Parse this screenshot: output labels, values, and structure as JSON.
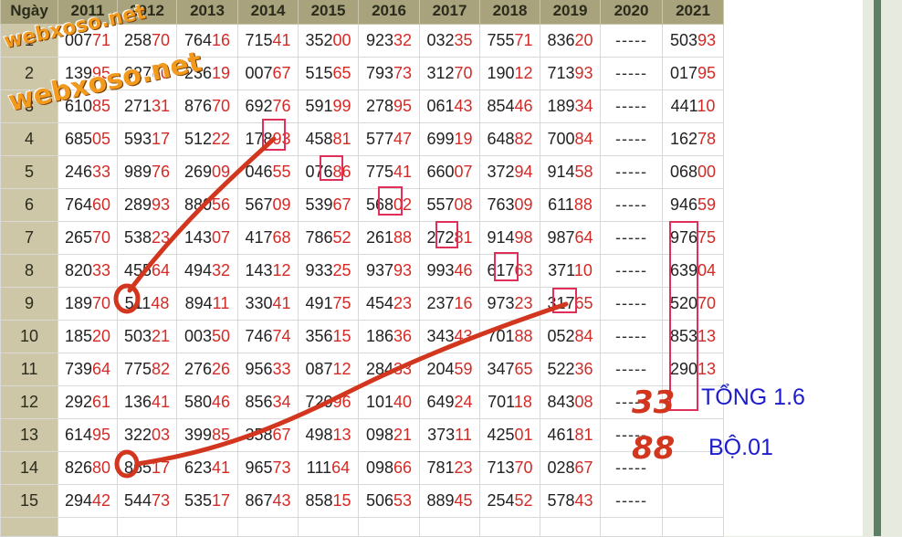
{
  "header": {
    "day_label": "Ngày",
    "years": [
      "2011",
      "2012",
      "2013",
      "2014",
      "2015",
      "2016",
      "2017",
      "2018",
      "2019",
      "2020",
      "2021"
    ]
  },
  "rows": [
    {
      "day": "1",
      "cells": [
        [
          "007",
          "71"
        ],
        [
          "258",
          "70"
        ],
        [
          "764",
          "16"
        ],
        [
          "715",
          "41"
        ],
        [
          "352",
          "00"
        ],
        [
          "923",
          "32"
        ],
        [
          "032",
          "35"
        ],
        [
          "755",
          "71"
        ],
        [
          "836",
          "20"
        ],
        [
          "-----",
          ""
        ],
        [
          "503",
          "93"
        ]
      ]
    },
    {
      "day": "2",
      "cells": [
        [
          "139",
          "95"
        ],
        [
          "627",
          "60"
        ],
        [
          "236",
          "19"
        ],
        [
          "007",
          "67"
        ],
        [
          "515",
          "65"
        ],
        [
          "793",
          "73"
        ],
        [
          "312",
          "70"
        ],
        [
          "190",
          "12"
        ],
        [
          "713",
          "93"
        ],
        [
          "-----",
          ""
        ],
        [
          "017",
          "95"
        ]
      ]
    },
    {
      "day": "3",
      "cells": [
        [
          "610",
          "85"
        ],
        [
          "271",
          "31"
        ],
        [
          "876",
          "70"
        ],
        [
          "692",
          "76"
        ],
        [
          "591",
          "99"
        ],
        [
          "278",
          "95"
        ],
        [
          "061",
          "43"
        ],
        [
          "854",
          "46"
        ],
        [
          "189",
          "34"
        ],
        [
          "-----",
          ""
        ],
        [
          "441",
          "10"
        ]
      ]
    },
    {
      "day": "4",
      "cells": [
        [
          "685",
          "05"
        ],
        [
          "593",
          "17"
        ],
        [
          "512",
          "22"
        ],
        [
          "178",
          "93"
        ],
        [
          "458",
          "81"
        ],
        [
          "577",
          "47"
        ],
        [
          "699",
          "19"
        ],
        [
          "648",
          "82"
        ],
        [
          "700",
          "84"
        ],
        [
          "-----",
          ""
        ],
        [
          "162",
          "78"
        ]
      ]
    },
    {
      "day": "5",
      "cells": [
        [
          "246",
          "33"
        ],
        [
          "989",
          "76"
        ],
        [
          "269",
          "09"
        ],
        [
          "046",
          "55"
        ],
        [
          "076",
          "86"
        ],
        [
          "775",
          "41"
        ],
        [
          "660",
          "07"
        ],
        [
          "372",
          "94"
        ],
        [
          "914",
          "58"
        ],
        [
          "-----",
          ""
        ],
        [
          "068",
          "00"
        ]
      ]
    },
    {
      "day": "6",
      "cells": [
        [
          "764",
          "60"
        ],
        [
          "289",
          "93"
        ],
        [
          "880",
          "56"
        ],
        [
          "567",
          "09"
        ],
        [
          "539",
          "67"
        ],
        [
          "568",
          "02"
        ],
        [
          "557",
          "08"
        ],
        [
          "763",
          "09"
        ],
        [
          "611",
          "88"
        ],
        [
          "-----",
          ""
        ],
        [
          "946",
          "59"
        ]
      ]
    },
    {
      "day": "7",
      "cells": [
        [
          "265",
          "70"
        ],
        [
          "538",
          "23"
        ],
        [
          "143",
          "07"
        ],
        [
          "417",
          "68"
        ],
        [
          "786",
          "52"
        ],
        [
          "261",
          "88"
        ],
        [
          "272",
          "81"
        ],
        [
          "914",
          "98"
        ],
        [
          "987",
          "64"
        ],
        [
          "-----",
          ""
        ],
        [
          "976",
          "75"
        ]
      ]
    },
    {
      "day": "8",
      "cells": [
        [
          "820",
          "33"
        ],
        [
          "455",
          "64"
        ],
        [
          "494",
          "32"
        ],
        [
          "143",
          "12"
        ],
        [
          "933",
          "25"
        ],
        [
          "937",
          "93"
        ],
        [
          "993",
          "46"
        ],
        [
          "617",
          "63"
        ],
        [
          "371",
          "10"
        ],
        [
          "-----",
          ""
        ],
        [
          "639",
          "04"
        ]
      ]
    },
    {
      "day": "9",
      "cells": [
        [
          "189",
          "70"
        ],
        [
          "511",
          "48"
        ],
        [
          "894",
          "11"
        ],
        [
          "330",
          "41"
        ],
        [
          "491",
          "75"
        ],
        [
          "454",
          "23"
        ],
        [
          "237",
          "16"
        ],
        [
          "973",
          "23"
        ],
        [
          "317",
          "65"
        ],
        [
          "-----",
          ""
        ],
        [
          "520",
          "70"
        ]
      ]
    },
    {
      "day": "10",
      "cells": [
        [
          "185",
          "20"
        ],
        [
          "503",
          "21"
        ],
        [
          "003",
          "50"
        ],
        [
          "746",
          "74"
        ],
        [
          "356",
          "15"
        ],
        [
          "186",
          "36"
        ],
        [
          "343",
          "43"
        ],
        [
          "701",
          "88"
        ],
        [
          "052",
          "84"
        ],
        [
          "-----",
          ""
        ],
        [
          "853",
          "13"
        ]
      ]
    },
    {
      "day": "11",
      "cells": [
        [
          "739",
          "64"
        ],
        [
          "775",
          "82"
        ],
        [
          "276",
          "26"
        ],
        [
          "956",
          "33"
        ],
        [
          "087",
          "12"
        ],
        [
          "284",
          "33"
        ],
        [
          "204",
          "59"
        ],
        [
          "347",
          "65"
        ],
        [
          "522",
          "36"
        ],
        [
          "-----",
          ""
        ],
        [
          "290",
          "13"
        ]
      ]
    },
    {
      "day": "12",
      "cells": [
        [
          "292",
          "61"
        ],
        [
          "136",
          "41"
        ],
        [
          "580",
          "46"
        ],
        [
          "856",
          "34"
        ],
        [
          "720",
          "96"
        ],
        [
          "101",
          "40"
        ],
        [
          "649",
          "24"
        ],
        [
          "701",
          "18"
        ],
        [
          "843",
          "08"
        ],
        [
          "-----",
          ""
        ],
        [
          "",
          ""
        ]
      ]
    },
    {
      "day": "13",
      "cells": [
        [
          "614",
          "95"
        ],
        [
          "322",
          "03"
        ],
        [
          "399",
          "85"
        ],
        [
          "358",
          "67"
        ],
        [
          "498",
          "13"
        ],
        [
          "098",
          "21"
        ],
        [
          "373",
          "11"
        ],
        [
          "425",
          "01"
        ],
        [
          "461",
          "81"
        ],
        [
          "-----",
          ""
        ],
        [
          "",
          ""
        ]
      ]
    },
    {
      "day": "14",
      "cells": [
        [
          "826",
          "80"
        ],
        [
          "865",
          "17"
        ],
        [
          "623",
          "41"
        ],
        [
          "965",
          "73"
        ],
        [
          "111",
          "64"
        ],
        [
          "098",
          "66"
        ],
        [
          "781",
          "23"
        ],
        [
          "713",
          "70"
        ],
        [
          "028",
          "67"
        ],
        [
          "-----",
          ""
        ],
        [
          "",
          ""
        ]
      ]
    },
    {
      "day": "15",
      "cells": [
        [
          "294",
          "42"
        ],
        [
          "544",
          "73"
        ],
        [
          "535",
          "17"
        ],
        [
          "867",
          "43"
        ],
        [
          "858",
          "15"
        ],
        [
          "506",
          "53"
        ],
        [
          "889",
          "45"
        ],
        [
          "254",
          "52"
        ],
        [
          "578",
          "43"
        ],
        [
          "-----",
          ""
        ],
        [
          "",
          ""
        ]
      ]
    }
  ],
  "watermarks": [
    "webxoso.net",
    "webxoso.net"
  ],
  "annotations": {
    "handwritten_numbers": [
      "33",
      "88"
    ],
    "note_total": "TỔNG 1.6",
    "note_set": "BỘ.01"
  },
  "colors": {
    "header_bg": "#a8a37c",
    "day_col_bg": "#cdc7a8",
    "tail_digits": "#d42a25",
    "marker": "#d2361e",
    "box": "#e0305a",
    "note_text": "#1c1ccd",
    "watermark": "#f29a1d"
  }
}
